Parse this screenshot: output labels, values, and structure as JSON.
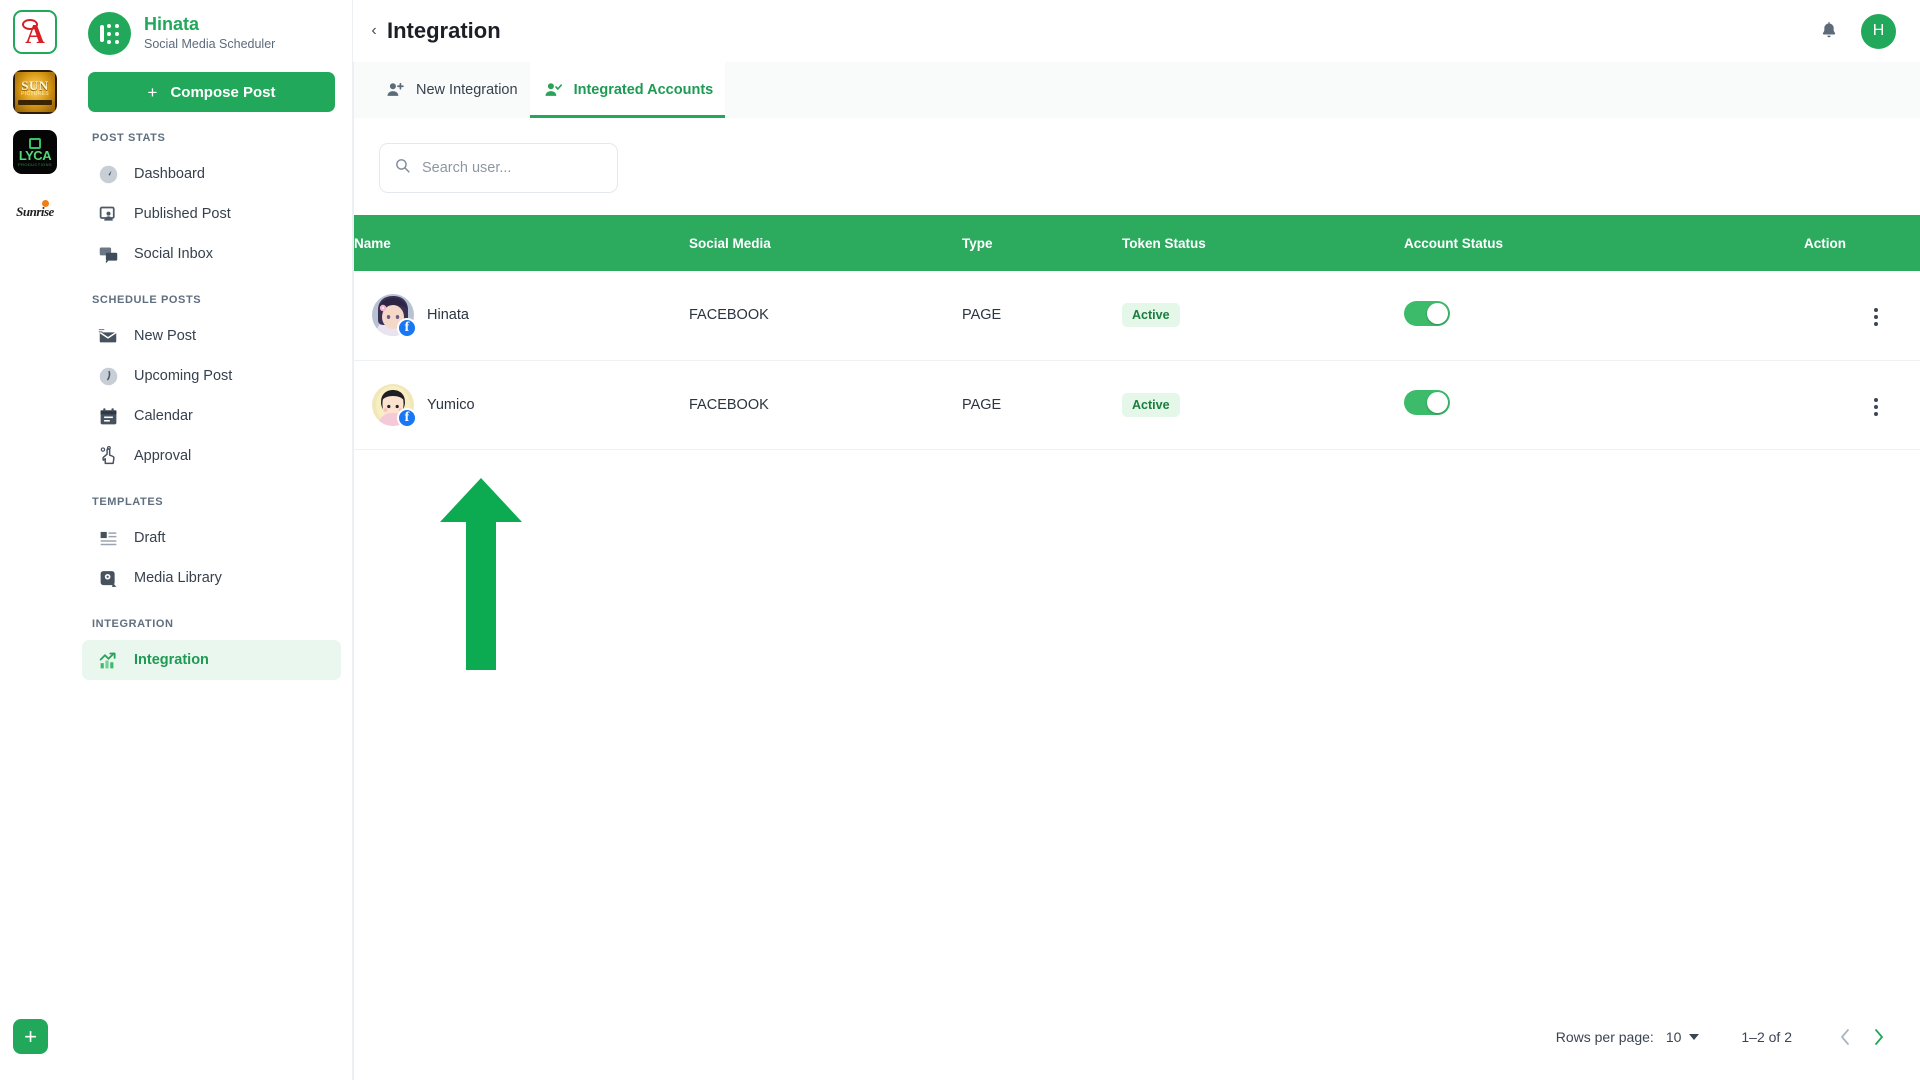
{
  "rail": {
    "tiles": [
      {
        "name": "workspace-ah",
        "label": "A"
      },
      {
        "name": "workspace-sun",
        "label": "SUN",
        "sub": "PICTURES"
      },
      {
        "name": "workspace-lyca",
        "label": "LYCA",
        "sub": "PRODUCTIONS"
      },
      {
        "name": "workspace-sunrise",
        "label": "Sunrise"
      }
    ],
    "add_label": "+"
  },
  "sidebar": {
    "brand": {
      "title": "Hinata",
      "subtitle": "Social Media Scheduler"
    },
    "compose": {
      "plus": "+",
      "label": "Compose Post"
    },
    "sections": [
      {
        "label": "POST STATS",
        "items": [
          {
            "label": "Dashboard",
            "icon": "dashboard-icon",
            "active": false
          },
          {
            "label": "Published Post",
            "icon": "published-post-icon",
            "active": false
          },
          {
            "label": "Social Inbox",
            "icon": "social-inbox-icon",
            "active": false
          }
        ]
      },
      {
        "label": "SCHEDULE POSTS",
        "items": [
          {
            "label": "New Post",
            "icon": "new-post-icon",
            "active": false
          },
          {
            "label": "Upcoming Post",
            "icon": "upcoming-post-icon",
            "active": false
          },
          {
            "label": "Calendar",
            "icon": "calendar-icon",
            "active": false
          },
          {
            "label": "Approval",
            "icon": "approval-icon",
            "active": false
          }
        ]
      },
      {
        "label": "TEMPLATES",
        "items": [
          {
            "label": "Draft",
            "icon": "draft-icon",
            "active": false
          },
          {
            "label": "Media Library",
            "icon": "media-library-icon",
            "active": false
          }
        ]
      },
      {
        "label": "INTEGRATION",
        "items": [
          {
            "label": "Integration",
            "icon": "integration-icon",
            "active": true
          }
        ]
      }
    ]
  },
  "topbar": {
    "collapse_chevron": "‹",
    "title": "Integration",
    "notification_icon": "bell-icon",
    "avatar_initial": "H"
  },
  "tabs": [
    {
      "label": "New Integration",
      "icon": "user-plus-icon",
      "active": false
    },
    {
      "label": "Integrated Accounts",
      "icon": "user-check-icon",
      "active": true
    }
  ],
  "search": {
    "placeholder": "Search user...",
    "value": "",
    "icon": "search-icon"
  },
  "table": {
    "columns": [
      "Name",
      "Social Media",
      "Type",
      "Token Status",
      "Account Status",
      "Action"
    ],
    "rows": [
      {
        "name": "Hinata",
        "avatar": "hinata-avatar",
        "social_badge": "facebook-badge",
        "social_media": "FACEBOOK",
        "type": "PAGE",
        "token_status": "Active",
        "account_status_on": true,
        "action_icon": "kebab-menu-icon"
      },
      {
        "name": "Yumico",
        "avatar": "yumico-avatar",
        "social_badge": "facebook-badge",
        "social_media": "FACEBOOK",
        "type": "PAGE",
        "token_status": "Active",
        "account_status_on": true,
        "action_icon": "kebab-menu-icon"
      }
    ]
  },
  "pagination": {
    "rows_per_page_label": "Rows per page:",
    "rows_per_page_value": "10",
    "range": "1–2 of 2",
    "prev_icon": "chevron-left-icon",
    "next_icon": "chevron-right-icon"
  },
  "annotation": {
    "arrow": "up-arrow-annotation",
    "color": "#0cab52"
  },
  "colors": {
    "brand_green": "#21a85a",
    "table_header_green": "#2cab5f",
    "badge_bg": "#e4f7e9",
    "badge_text": "#1c7d3f",
    "facebook_blue": "#1877f2"
  }
}
